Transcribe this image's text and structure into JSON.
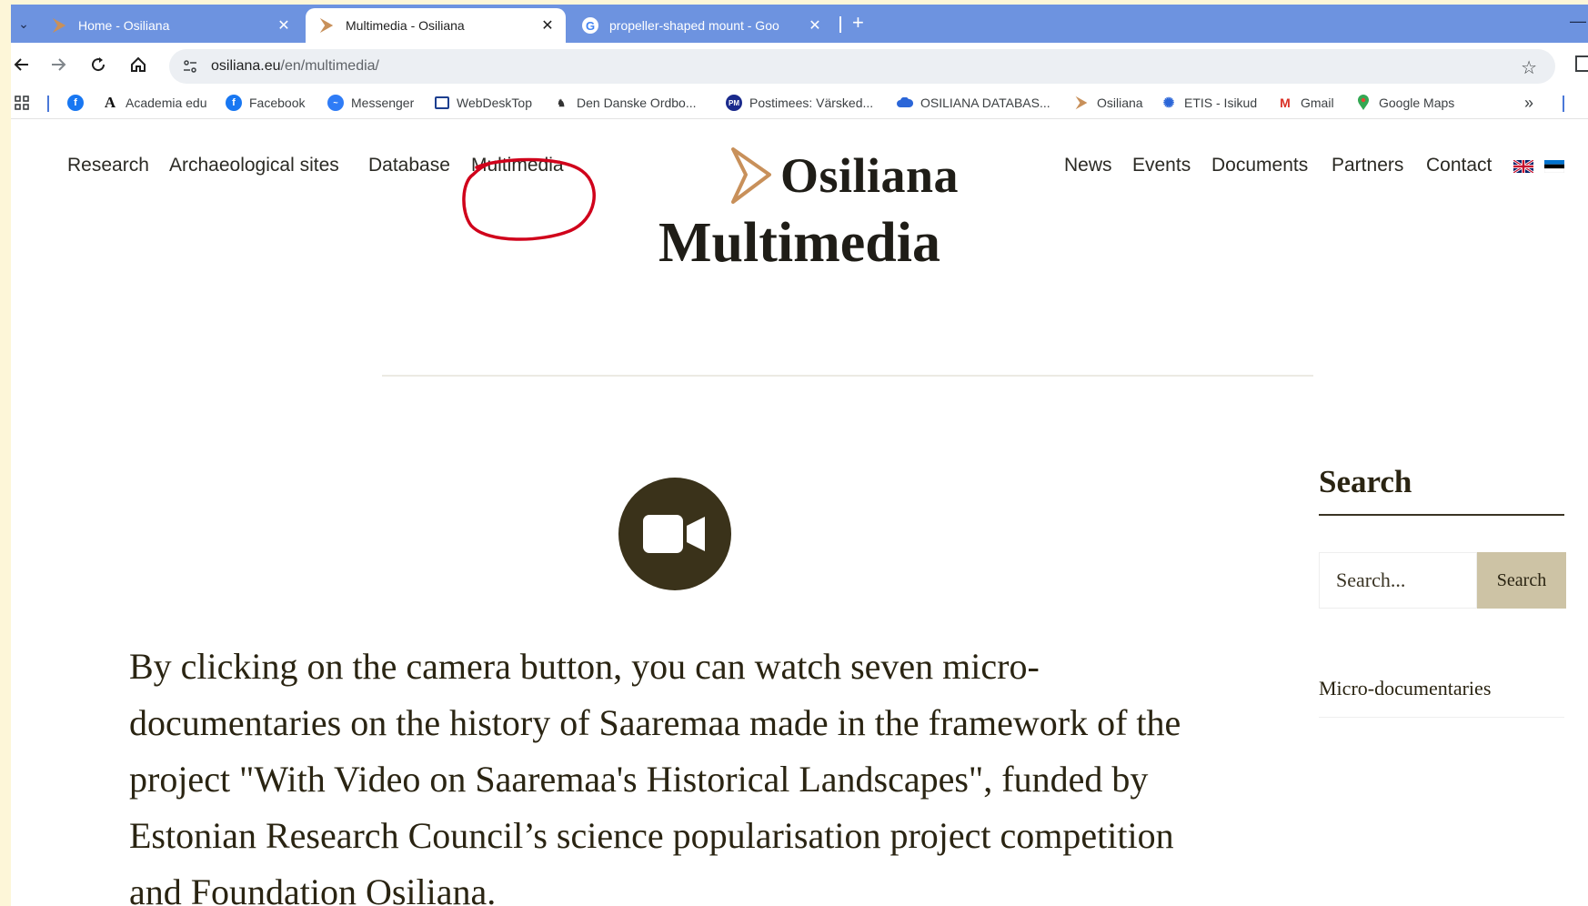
{
  "browser": {
    "tabs": [
      {
        "title": "Home - Osiliana",
        "active": false,
        "icon": "osiliana-arrow-icon"
      },
      {
        "title": "Multimedia - Osiliana",
        "active": true,
        "icon": "osiliana-arrow-icon"
      },
      {
        "title": "propeller-shaped mount - Goo",
        "active": false,
        "icon": "google-icon"
      }
    ],
    "close_glyph": "✕",
    "new_tab_glyph": "+",
    "url_host": "osiliana.eu",
    "url_path": "/en/multimedia/",
    "bookmarks": [
      {
        "label": "",
        "icon": "facebook-icon"
      },
      {
        "label": "Academia edu",
        "icon": "academia-icon"
      },
      {
        "label": "Facebook",
        "icon": "facebook-icon"
      },
      {
        "label": "Messenger",
        "icon": "messenger-icon"
      },
      {
        "label": "WebDeskTop",
        "icon": "webdesktop-icon"
      },
      {
        "label": "Den Danske Ordbo...",
        "icon": "ordbog-icon"
      },
      {
        "label": "Postimees: Värsked...",
        "icon": "postimees-icon"
      },
      {
        "label": "OSILIANA DATABAS...",
        "icon": "cloud-icon"
      },
      {
        "label": "Osiliana",
        "icon": "osiliana-arrow-icon"
      },
      {
        "label": "ETIS - Isikud",
        "icon": "etis-icon"
      },
      {
        "label": "Gmail",
        "icon": "gmail-icon"
      },
      {
        "label": "Google Maps",
        "icon": "maps-pin-icon"
      }
    ],
    "more_glyph": "»"
  },
  "site": {
    "nav_left": [
      "Research",
      "Archaeological sites",
      "Database",
      "Multimedia"
    ],
    "nav_right": [
      "News",
      "Events",
      "Documents",
      "Partners",
      "Contact"
    ],
    "logo_text": "Osiliana",
    "colors": {
      "accent": "#c8905a",
      "dark": "#3a321a",
      "button": "#cdc3a5",
      "annotation": "#d0021b"
    }
  },
  "main": {
    "title": "Multimedia",
    "intro": "By clicking on the camera button, you can watch seven micro-documentaries on the history of Saaremaa made in the framework of the project \"With Video on Saaremaa's Historical Landscapes\", funded by Estonian Research Council’s science popularisation project competition and Foundation Osiliana."
  },
  "sidebar": {
    "heading": "Search",
    "search_placeholder": "Search...",
    "search_button": "Search",
    "link": "Micro-documentaries"
  }
}
